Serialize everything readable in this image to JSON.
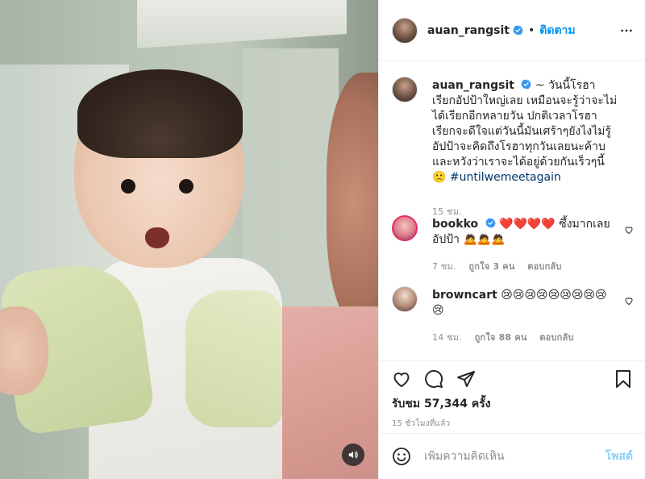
{
  "post": {
    "author": "auan_rangsit",
    "verified": true,
    "follow_label": "ติดตาม",
    "separator": "•",
    "caption_username": "auan_rangsit",
    "caption_suffix": "~",
    "caption_text": "วันนี้โรฮาเรียกอัปป้าใหญ่เลย เหมือนจะรู้ว่าจะไม่ได้เรียกอีกหลายวัน ปกติเวลาโรฮาเรียกจะดีใจแต่วันนี้มันเศร้าๆยังไงไม่รู้ อัปป้าจะคิดถึงโรฮาทุกวันเลยนะค้าบ และหวังว่าเราจะได้อยู่ด้วยกันเร็วๆนี้ 🙁",
    "hashtag": "#untilwemeetagain",
    "caption_time": "15 ชม.",
    "views_label": "รับชม 57,344 ครั้ง",
    "posted_ago": "15 ชั่วโมงที่แล้ว"
  },
  "comments": [
    {
      "username": "bookko",
      "text": "❤️❤️❤️❤️ ซึ้งมากเลยอัปป้า 🙇🙇🙇",
      "time": "7 ชม.",
      "likes": "ถูกใจ 3 คน",
      "reply": "ตอบกลับ"
    },
    {
      "username": "browncart",
      "text": "😢😢😢😢😢😢😢😢😢😢",
      "time": "14 ชม.",
      "likes": "ถูกใจ 88 คน",
      "reply": "ตอบกลับ"
    }
  ],
  "composer": {
    "placeholder": "เพิ่มความคิดเห็น",
    "post_label": "โพสต์"
  },
  "colors": {
    "accent": "#0095f6",
    "hashtag": "#00376b",
    "muted": "#8e8e8e"
  },
  "icons": [
    "more-options-icon",
    "verified-badge-icon",
    "heart-icon",
    "comment-icon",
    "share-icon",
    "save-icon",
    "emoji-icon",
    "mute-icon"
  ]
}
